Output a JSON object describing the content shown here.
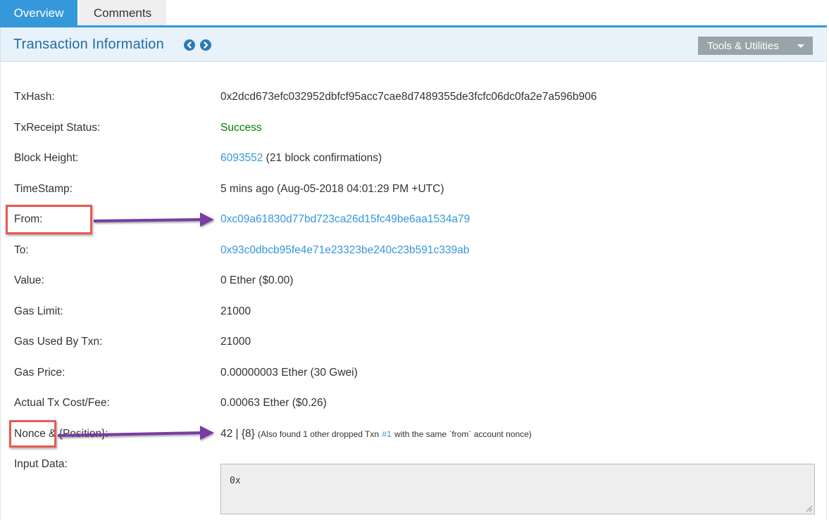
{
  "tabs": {
    "overview": "Overview",
    "comments": "Comments"
  },
  "header": {
    "title": "Transaction Information",
    "tools_label": "Tools & Utilities"
  },
  "rows": {
    "txhash": {
      "label": "TxHash:",
      "value": "0x2dcd673efc032952dbfcf95acc7cae8d7489355de3fcfc06dc0fa2e7a596b906"
    },
    "status": {
      "label": "TxReceipt Status:",
      "value": "Success"
    },
    "block": {
      "label": "Block Height:",
      "block_number": "6093552",
      "confirmations": "(21 block confirmations)"
    },
    "timestamp": {
      "label": "TimeStamp:",
      "value": "5 mins ago (Aug-05-2018 04:01:29 PM +UTC)"
    },
    "from": {
      "label": "From:",
      "value": "0xc09a61830d77bd723ca26d15fc49be6aa1534a79"
    },
    "to": {
      "label": "To:",
      "value": "0x93c0dbcb95fe4e71e23323be240c23b591c339ab"
    },
    "value": {
      "label": "Value:",
      "value": "0 Ether ($0.00)"
    },
    "gas_limit": {
      "label": "Gas Limit:",
      "value": "21000"
    },
    "gas_used": {
      "label": "Gas Used By Txn:",
      "value": "21000"
    },
    "gas_price": {
      "label": "Gas Price:",
      "value": "0.00000003 Ether (30 Gwei)"
    },
    "tx_cost": {
      "label": "Actual Tx Cost/Fee:",
      "value": "0.00063 Ether ($0.26)"
    },
    "nonce": {
      "label_nonce": "Nonce",
      "label_rest": "& {Position}:",
      "value": "42 | {8}",
      "note_prefix": "(Also found 1 other dropped Txn",
      "note_link": "#1",
      "note_suffix": "with the same `from` account nonce)"
    },
    "input": {
      "label": "Input Data:",
      "value": "0x"
    }
  },
  "colors": {
    "accent": "#3498db",
    "success": "#008000",
    "title": "#1e6ea7",
    "annotation_box": "#e85a52",
    "annotation_arrow": "#7a3aa3"
  },
  "icons": {
    "prev": "chevron-left-circle-icon",
    "next": "chevron-right-circle-icon",
    "dropdown": "caret-down-icon",
    "resize": "resize-grip-icon"
  }
}
